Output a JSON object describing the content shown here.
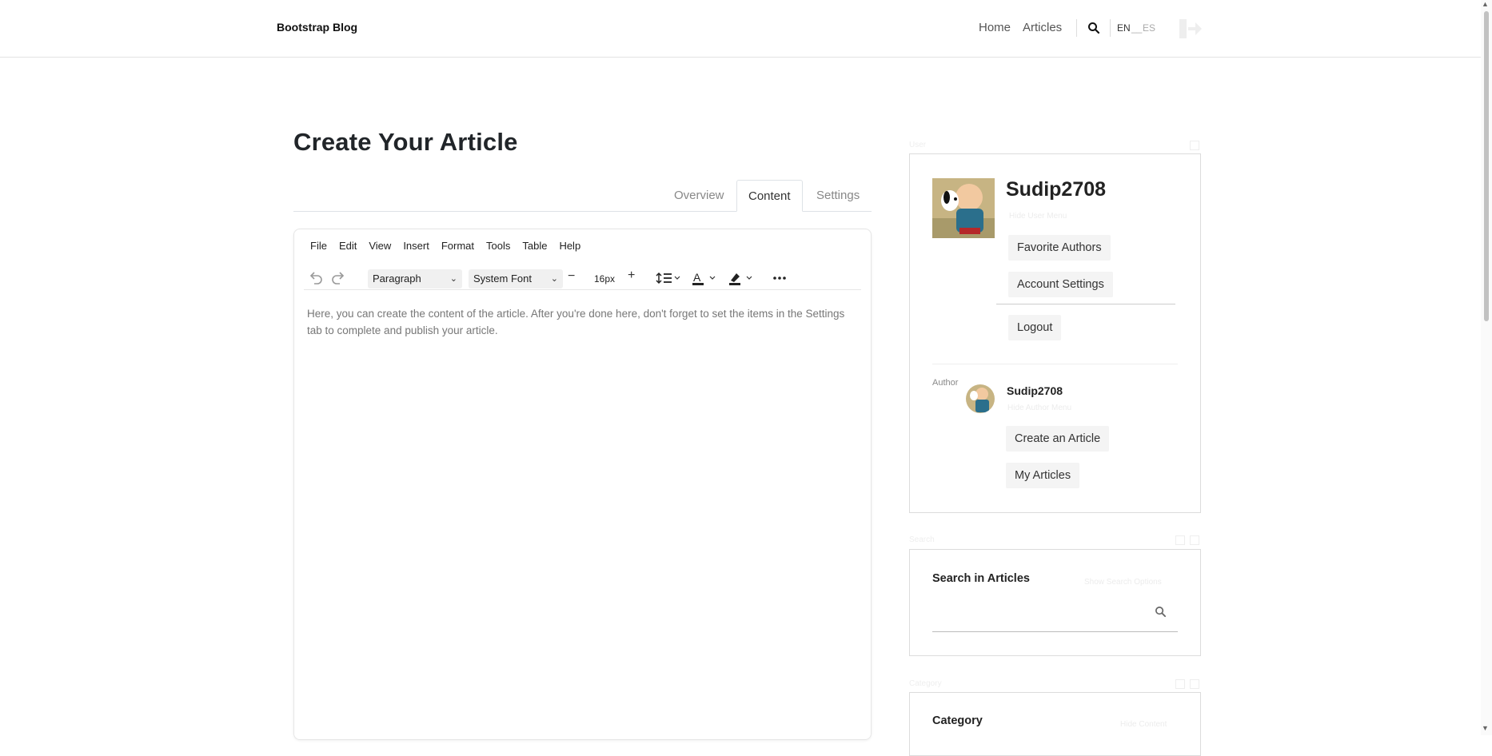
{
  "navbar": {
    "brand": "Bootstrap Blog",
    "links": [
      "Home",
      "Articles"
    ],
    "languages": {
      "active": "EN",
      "separator": "__",
      "inactive": "ES"
    }
  },
  "page": {
    "title": "Create Your Article",
    "tabs": [
      {
        "label": "Overview",
        "active": false
      },
      {
        "label": "Content",
        "active": true
      },
      {
        "label": "Settings",
        "active": false
      }
    ]
  },
  "editor": {
    "menu": [
      "File",
      "Edit",
      "View",
      "Insert",
      "Format",
      "Tools",
      "Table",
      "Help"
    ],
    "block_format": "Paragraph",
    "font_family": "System Font",
    "font_size": "16px",
    "placeholder": "Here, you can create the content of the article. After you're done here, don't forget to set the items in the Settings tab to complete and publish your article."
  },
  "sidebar": {
    "user_section_label": "User",
    "user": {
      "name": "Sudip2708",
      "hide_menu": "Hide User Menu",
      "buttons": [
        "Favorite Authors",
        "Account Settings",
        "Logout"
      ]
    },
    "author": {
      "label": "Author",
      "name": "Sudip2708",
      "hide_menu": "Hide Author Menu",
      "buttons": [
        "Create an Article",
        "My Articles"
      ]
    },
    "search_section_label": "Search",
    "search": {
      "title": "Search in Articles",
      "show_options": "Show Search Options"
    },
    "category_section_label": "Category",
    "category": {
      "title": "Category",
      "hide_content": "Hide Content"
    }
  },
  "colors": {
    "text": "#212529",
    "muted": "#888888",
    "border": "#dcdcdc",
    "button_bg": "#f4f4f4"
  }
}
